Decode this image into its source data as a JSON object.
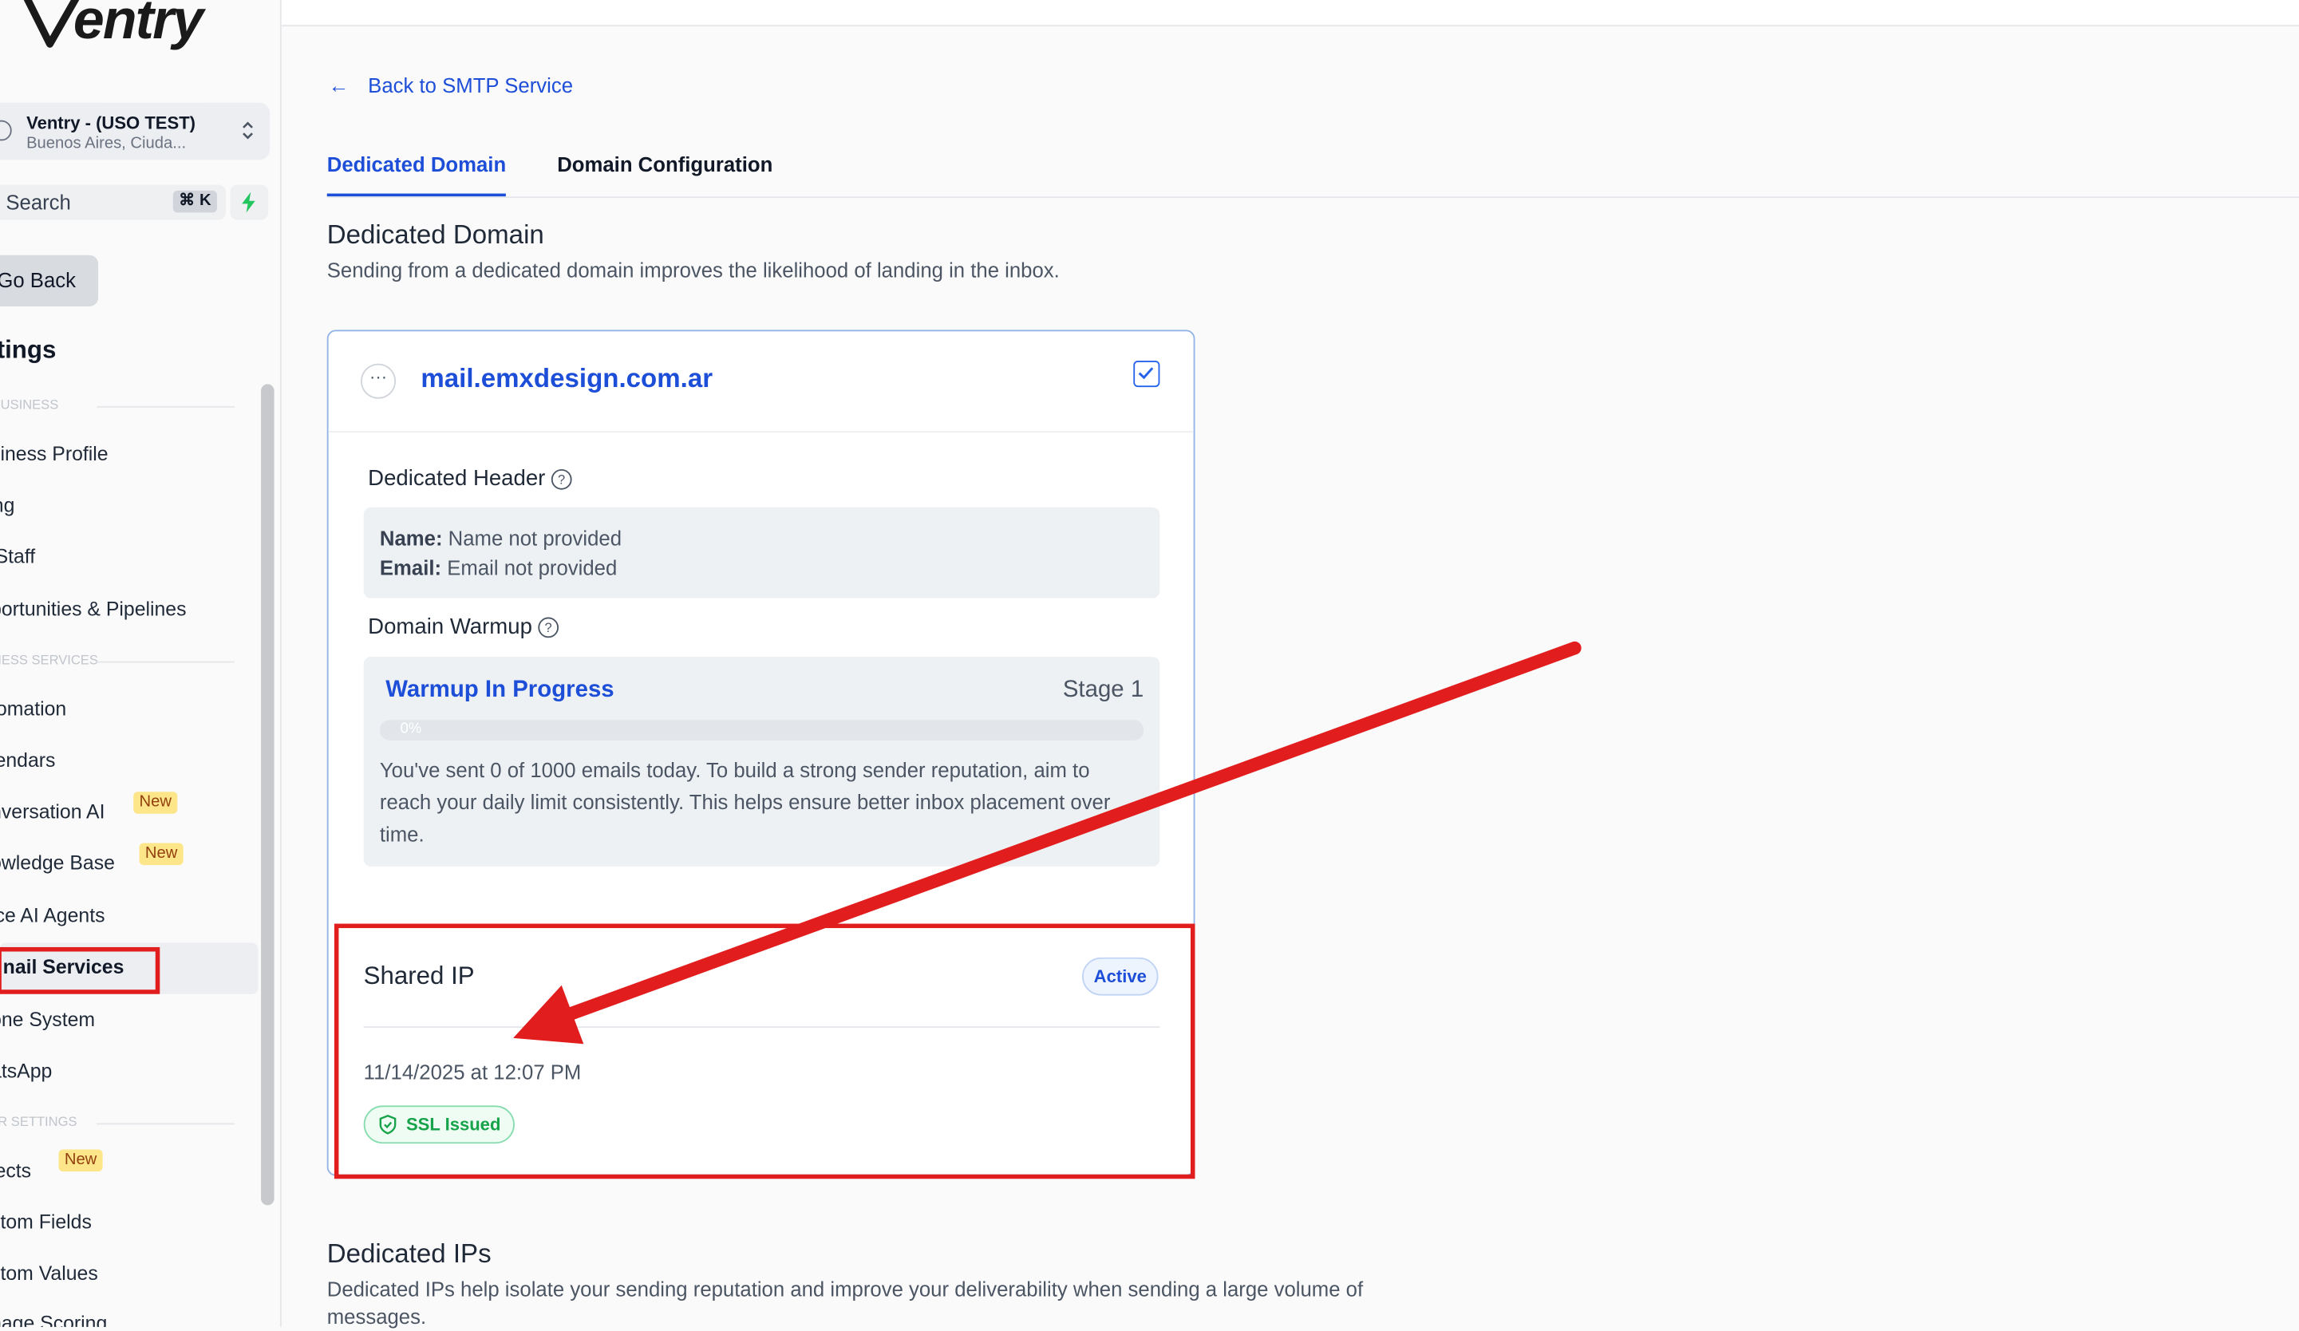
{
  "sidebar": {
    "logo_text": "entry",
    "account": {
      "name": "Ventry - (USO TEST)",
      "location": "Buenos Aires, Ciuda..."
    },
    "search": {
      "label": "Search",
      "shortcut": "⌘ K"
    },
    "go_back": "Go Back",
    "title": "ttings",
    "sections": {
      "business": "Y BUSINESS",
      "business_services": "SINESS SERVICES",
      "other_settings": "HER SETTINGS"
    },
    "items": [
      {
        "label": "usiness Profile"
      },
      {
        "label": "lling"
      },
      {
        "label": "y Staff"
      },
      {
        "label": "pportunities & Pipelines"
      },
      {
        "label": "utomation"
      },
      {
        "label": "alendars"
      },
      {
        "label": "onversation AI",
        "badge": "New"
      },
      {
        "label": "nowledge Base",
        "badge": "New"
      },
      {
        "label": "oice AI Agents"
      },
      {
        "label": "nail Services"
      },
      {
        "label": "hone System"
      },
      {
        "label": "hatsApp"
      },
      {
        "label": "bjects",
        "badge": "New"
      },
      {
        "label": "ustom Fields"
      },
      {
        "label": "ustom Values"
      },
      {
        "label": "anage Scoring"
      }
    ]
  },
  "main": {
    "back_link": "Back to SMTP Service",
    "tabs": [
      {
        "label": "Dedicated Domain",
        "active": true
      },
      {
        "label": "Domain Configuration",
        "active": false
      }
    ],
    "dedicated_domain": {
      "title": "Dedicated Domain",
      "subtitle": "Sending from a dedicated domain improves the likelihood of landing in the inbox."
    },
    "card": {
      "domain": "mail.emxdesign.com.ar",
      "dedicated_header": {
        "label": "Dedicated Header",
        "name_label": "Name:",
        "name_value": "Name not provided",
        "email_label": "Email:",
        "email_value": "Email not provided"
      },
      "domain_warmup": {
        "label": "Domain Warmup",
        "status": "Warmup In Progress",
        "stage": "Stage 1",
        "progress_label": "0%",
        "progress_value": 0,
        "message": "You've sent 0 of 1000 emails today. To build a strong sender reputation, aim to reach your daily limit consistently. This helps ensure better inbox placement over time."
      },
      "shared_ip": {
        "title": "Shared IP",
        "status": "Active",
        "date": "11/14/2025 at 12:07 PM",
        "ssl": "SSL Issued"
      }
    },
    "dedicated_ips": {
      "title": "Dedicated IPs",
      "subtitle": "Dedicated IPs help isolate your sending reputation and improve your deliverability when sending a large volume of messages."
    }
  },
  "colors": {
    "accent": "#1d4ed8",
    "annotation": "#e11d1d",
    "success": "#16a34a",
    "badge": "#fde68a"
  },
  "icons": {
    "back": "arrow-left-icon",
    "help": "question-circle-icon",
    "more": "ellipsis-icon",
    "checkbox": "check-square-icon",
    "ssl": "shield-check-icon",
    "quick_action": "lightning-bolt-icon",
    "account": "location-pin-icon",
    "switch": "chevron-up-down-icon"
  }
}
